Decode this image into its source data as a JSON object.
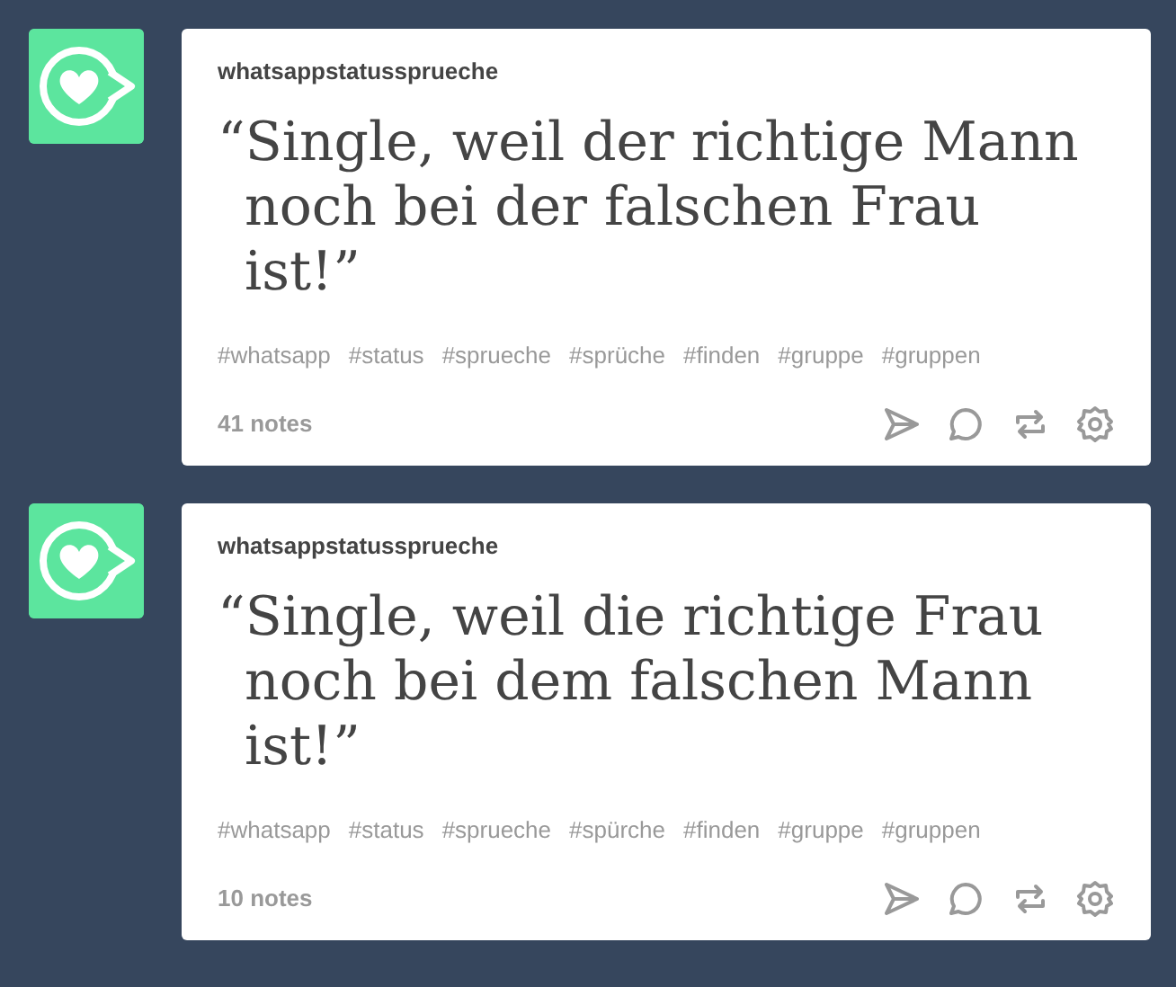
{
  "posts": [
    {
      "blog": "whatsappstatussprueche",
      "quote": "“Single, weil der richtige Mann noch bei der falschen Frau ist!”",
      "tags": [
        "#whatsapp",
        "#status",
        "#sprueche",
        "#sprüche",
        "#finden",
        "#gruppe",
        "#gruppen"
      ],
      "notes": "41 notes"
    },
    {
      "blog": "whatsappstatussprueche",
      "quote": "“Single, weil die richtige Frau noch bei dem falschen Mann ist!”",
      "tags": [
        "#whatsapp",
        "#status",
        "#sprueche",
        "#spürche",
        "#finden",
        "#gruppe",
        "#gruppen"
      ],
      "notes": "10 notes"
    }
  ]
}
